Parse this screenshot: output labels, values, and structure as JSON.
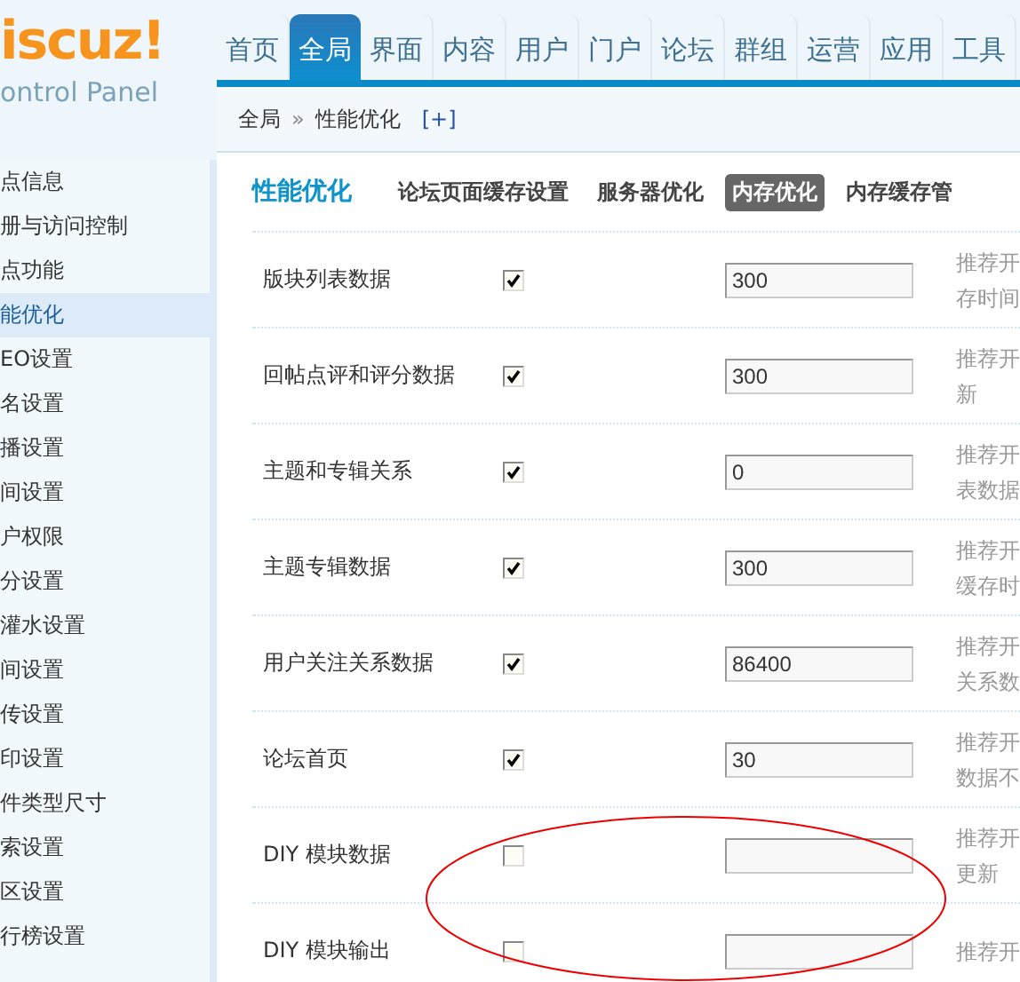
{
  "logo": {
    "brand": "iscuz!",
    "subtitle": "ontrol Panel"
  },
  "nav": [
    {
      "label": "首页",
      "selected": false
    },
    {
      "label": "全局",
      "selected": true
    },
    {
      "label": "界面",
      "selected": false
    },
    {
      "label": "内容",
      "selected": false
    },
    {
      "label": "用户",
      "selected": false
    },
    {
      "label": "门户",
      "selected": false
    },
    {
      "label": "论坛",
      "selected": false
    },
    {
      "label": "群组",
      "selected": false
    },
    {
      "label": "运营",
      "selected": false
    },
    {
      "label": "应用",
      "selected": false
    },
    {
      "label": "工具",
      "selected": false
    }
  ],
  "breadcrumb": {
    "items": [
      "全局",
      "性能优化"
    ],
    "separator": "»",
    "add": "[+]"
  },
  "sidebar": {
    "items": [
      {
        "label": "点信息",
        "selected": false
      },
      {
        "label": "册与访问控制",
        "selected": false
      },
      {
        "label": "点功能",
        "selected": false
      },
      {
        "label": "能优化",
        "selected": true
      },
      {
        "label": "EO设置",
        "selected": false
      },
      {
        "label": "名设置",
        "selected": false
      },
      {
        "label": "播设置",
        "selected": false
      },
      {
        "label": "间设置",
        "selected": false
      },
      {
        "label": "户权限",
        "selected": false
      },
      {
        "label": "分设置",
        "selected": false
      },
      {
        "label": "灌水设置",
        "selected": false
      },
      {
        "label": "间设置",
        "selected": false
      },
      {
        "label": "传设置",
        "selected": false
      },
      {
        "label": "印设置",
        "selected": false
      },
      {
        "label": "件类型尺寸",
        "selected": false
      },
      {
        "label": "索设置",
        "selected": false
      },
      {
        "label": "区设置",
        "selected": false
      },
      {
        "label": "行榜设置",
        "selected": false
      }
    ]
  },
  "page": {
    "title": "性能优化",
    "tabs": [
      {
        "label": "论坛页面缓存设置",
        "selected": false
      },
      {
        "label": "服务器优化",
        "selected": false
      },
      {
        "label": "内存优化",
        "selected": true
      },
      {
        "label": "内存缓存管",
        "selected": false
      }
    ]
  },
  "settings": [
    {
      "label": "版块列表数据",
      "checked": true,
      "value": "300",
      "hint": [
        "推荐开",
        "存时间"
      ]
    },
    {
      "label": "回帖点评和评分数据",
      "checked": true,
      "value": "300",
      "hint": [
        "推荐开",
        "新"
      ]
    },
    {
      "label": "主题和专辑关系",
      "checked": true,
      "value": "0",
      "hint": [
        "推荐开",
        "表数据"
      ]
    },
    {
      "label": "主题专辑数据",
      "checked": true,
      "value": "300",
      "hint": [
        "推荐开",
        "缓存时"
      ]
    },
    {
      "label": "用户关注关系数据",
      "checked": true,
      "value": "86400",
      "hint": [
        "推荐开",
        "关系数"
      ]
    },
    {
      "label": "论坛首页",
      "checked": true,
      "value": "30",
      "hint": [
        "推荐开",
        "数据不"
      ]
    },
    {
      "label": "DIY 模块数据",
      "checked": false,
      "hint": [
        "推荐开",
        "更新"
      ]
    },
    {
      "label": "DIY 模块输出",
      "checked": false,
      "hint": [
        "推荐开"
      ]
    }
  ]
}
